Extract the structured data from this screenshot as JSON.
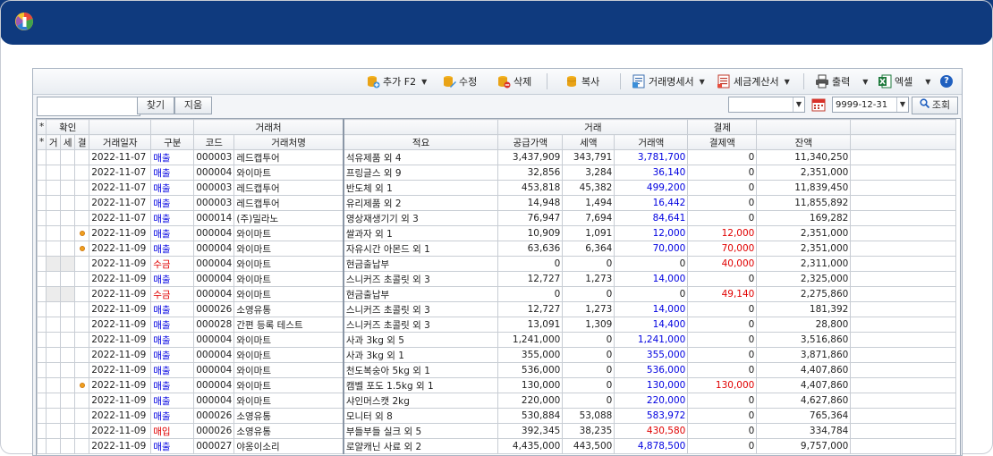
{
  "toolbar": {
    "add_label": "추가 F2",
    "edit_label": "수정",
    "delete_label": "삭제",
    "copy_label": "복사",
    "statement_label": "거래명세서",
    "tax_invoice_label": "세금계산서",
    "print_label": "출력",
    "excel_label": "엑셀",
    "help_icon": "help-icon"
  },
  "search": {
    "value": "",
    "find_label": "찾기",
    "clear_label": "지움",
    "combo_value": "",
    "date_value": "9999-12-31",
    "query_label": "조회"
  },
  "table": {
    "group_headers": {
      "confirm": "확인",
      "partner": "거래처",
      "trade": "거래",
      "payment": "결제"
    },
    "headers": {
      "star1": "*",
      "star2": "*",
      "c1": "거",
      "c2": "세",
      "c3": "결",
      "date": "거래일자",
      "type": "구분",
      "code": "코드",
      "partner_name": "거래처명",
      "summary": "적요",
      "supply": "공급가액",
      "tax": "세액",
      "amount": "거래액",
      "paid": "결제액",
      "balance": "잔액"
    },
    "rows": [
      {
        "dot": false,
        "date": "2022-11-07",
        "type": "매출",
        "type_color": "blue",
        "code": "000003",
        "partner": "레드캡투어",
        "summary": "석유제품 외 4",
        "supply": "3,437,909",
        "tax": "343,791",
        "amount": "3,781,700",
        "amount_color": "blue",
        "paid": "0",
        "paid_color": "black",
        "balance": "11,340,250"
      },
      {
        "dot": false,
        "date": "2022-11-07",
        "type": "매출",
        "type_color": "blue",
        "code": "000004",
        "partner": "와이마트",
        "summary": "프링글스 외 9",
        "supply": "32,856",
        "tax": "3,284",
        "amount": "36,140",
        "amount_color": "blue",
        "paid": "0",
        "paid_color": "black",
        "balance": "2,351,000"
      },
      {
        "dot": false,
        "date": "2022-11-07",
        "type": "매출",
        "type_color": "blue",
        "code": "000003",
        "partner": "레드캡투어",
        "summary": "반도체 외 1",
        "supply": "453,818",
        "tax": "45,382",
        "amount": "499,200",
        "amount_color": "blue",
        "paid": "0",
        "paid_color": "black",
        "balance": "11,839,450"
      },
      {
        "dot": false,
        "date": "2022-11-07",
        "type": "매출",
        "type_color": "blue",
        "code": "000003",
        "partner": "레드캡투어",
        "summary": "유리제품 외 2",
        "supply": "14,948",
        "tax": "1,494",
        "amount": "16,442",
        "amount_color": "blue",
        "paid": "0",
        "paid_color": "black",
        "balance": "11,855,892"
      },
      {
        "dot": false,
        "date": "2022-11-07",
        "type": "매출",
        "type_color": "blue",
        "code": "000014",
        "partner": "(주)밀라노",
        "summary": "영상재생기기 외 3",
        "supply": "76,947",
        "tax": "7,694",
        "amount": "84,641",
        "amount_color": "blue",
        "paid": "0",
        "paid_color": "black",
        "balance": "169,282"
      },
      {
        "dot": true,
        "date": "2022-11-09",
        "type": "매출",
        "type_color": "blue",
        "code": "000004",
        "partner": "와이마트",
        "summary": "쌀과자 외 1",
        "supply": "10,909",
        "tax": "1,091",
        "amount": "12,000",
        "amount_color": "blue",
        "paid": "12,000",
        "paid_color": "red",
        "balance": "2,351,000"
      },
      {
        "dot": true,
        "date": "2022-11-09",
        "type": "매출",
        "type_color": "blue",
        "code": "000004",
        "partner": "와이마트",
        "summary": "자유시간 아몬드 외 1",
        "supply": "63,636",
        "tax": "6,364",
        "amount": "70,000",
        "amount_color": "blue",
        "paid": "70,000",
        "paid_color": "red",
        "balance": "2,351,000"
      },
      {
        "dot": false,
        "sel": true,
        "date": "2022-11-09",
        "type": "수금",
        "type_color": "red",
        "code": "000004",
        "partner": "와이마트",
        "summary": "현금출납부",
        "supply": "0",
        "tax": "0",
        "amount": "0",
        "amount_color": "black",
        "paid": "40,000",
        "paid_color": "red",
        "balance": "2,311,000"
      },
      {
        "dot": false,
        "date": "2022-11-09",
        "type": "매출",
        "type_color": "blue",
        "code": "000004",
        "partner": "와이마트",
        "summary": "스니커즈 초콜릿 외 3",
        "supply": "12,727",
        "tax": "1,273",
        "amount": "14,000",
        "amount_color": "blue",
        "paid": "0",
        "paid_color": "black",
        "balance": "2,325,000"
      },
      {
        "dot": false,
        "sel": true,
        "date": "2022-11-09",
        "type": "수금",
        "type_color": "red",
        "code": "000004",
        "partner": "와이마트",
        "summary": "현금출납부",
        "supply": "0",
        "tax": "0",
        "amount": "0",
        "amount_color": "black",
        "paid": "49,140",
        "paid_color": "red",
        "balance": "2,275,860"
      },
      {
        "dot": false,
        "date": "2022-11-09",
        "type": "매출",
        "type_color": "blue",
        "code": "000026",
        "partner": "소영유통",
        "summary": "스니커즈 초콜릿 외 3",
        "supply": "12,727",
        "tax": "1,273",
        "amount": "14,000",
        "amount_color": "blue",
        "paid": "0",
        "paid_color": "black",
        "balance": "181,392"
      },
      {
        "dot": false,
        "date": "2022-11-09",
        "type": "매출",
        "type_color": "blue",
        "code": "000028",
        "partner": "간편 등록 테스트",
        "summary": "스니커즈 초콜릿 외 3",
        "supply": "13,091",
        "tax": "1,309",
        "amount": "14,400",
        "amount_color": "blue",
        "paid": "0",
        "paid_color": "black",
        "balance": "28,800"
      },
      {
        "dot": false,
        "date": "2022-11-09",
        "type": "매출",
        "type_color": "blue",
        "code": "000004",
        "partner": "와이마트",
        "summary": "사과 3kg 외 5",
        "supply": "1,241,000",
        "tax": "0",
        "amount": "1,241,000",
        "amount_color": "blue",
        "paid": "0",
        "paid_color": "black",
        "balance": "3,516,860"
      },
      {
        "dot": false,
        "date": "2022-11-09",
        "type": "매출",
        "type_color": "blue",
        "code": "000004",
        "partner": "와이마트",
        "summary": "사과 3kg 외 1",
        "supply": "355,000",
        "tax": "0",
        "amount": "355,000",
        "amount_color": "blue",
        "paid": "0",
        "paid_color": "black",
        "balance": "3,871,860"
      },
      {
        "dot": false,
        "date": "2022-11-09",
        "type": "매출",
        "type_color": "blue",
        "code": "000004",
        "partner": "와이마트",
        "summary": "천도복숭아 5kg 외 1",
        "supply": "536,000",
        "tax": "0",
        "amount": "536,000",
        "amount_color": "blue",
        "paid": "0",
        "paid_color": "black",
        "balance": "4,407,860"
      },
      {
        "dot": true,
        "date": "2022-11-09",
        "type": "매출",
        "type_color": "blue",
        "code": "000004",
        "partner": "와이마트",
        "summary": "캠벨 포도 1.5kg 외 1",
        "supply": "130,000",
        "tax": "0",
        "amount": "130,000",
        "amount_color": "blue",
        "paid": "130,000",
        "paid_color": "red",
        "balance": "4,407,860"
      },
      {
        "dot": false,
        "date": "2022-11-09",
        "type": "매출",
        "type_color": "blue",
        "code": "000004",
        "partner": "와이마트",
        "summary": "샤인머스캣 2kg",
        "supply": "220,000",
        "tax": "0",
        "amount": "220,000",
        "amount_color": "blue",
        "paid": "0",
        "paid_color": "black",
        "balance": "4,627,860"
      },
      {
        "dot": false,
        "date": "2022-11-09",
        "type": "매출",
        "type_color": "blue",
        "code": "000026",
        "partner": "소영유통",
        "summary": "모니터 외 8",
        "supply": "530,884",
        "tax": "53,088",
        "amount": "583,972",
        "amount_color": "blue",
        "paid": "0",
        "paid_color": "black",
        "balance": "765,364"
      },
      {
        "dot": false,
        "date": "2022-11-09",
        "type": "매입",
        "type_color": "red",
        "code": "000026",
        "partner": "소영유통",
        "summary": "부들부들 실크 외 5",
        "supply": "392,345",
        "tax": "38,235",
        "amount": "430,580",
        "amount_color": "red",
        "paid": "0",
        "paid_color": "black",
        "balance": "334,784"
      },
      {
        "dot": false,
        "date": "2022-11-09",
        "type": "매출",
        "type_color": "blue",
        "code": "000027",
        "partner": "야옹이소리",
        "summary": "로얄캐닌 사료 외 2",
        "supply": "4,435,000",
        "tax": "443,500",
        "amount": "4,878,500",
        "amount_color": "blue",
        "paid": "0",
        "paid_color": "black",
        "balance": "9,757,000"
      }
    ]
  },
  "colors": {
    "titlebar": "#0f3a7e",
    "blue": "#0000e0",
    "red": "#e00000"
  }
}
